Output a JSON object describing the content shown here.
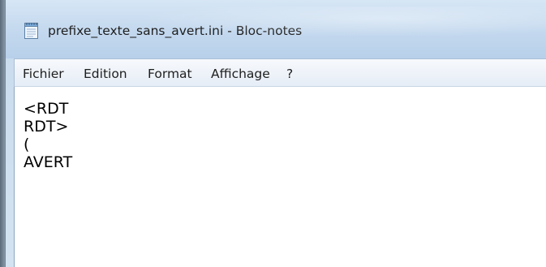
{
  "window": {
    "title": "prefixe_texte_sans_avert.ini - Bloc-notes",
    "icon": "notepad-icon"
  },
  "menu": {
    "items": [
      {
        "label": "Fichier"
      },
      {
        "label": "Edition"
      },
      {
        "label": "Format"
      },
      {
        "label": "Affichage"
      },
      {
        "label": "?"
      }
    ]
  },
  "editor": {
    "lines": [
      "<RDT",
      "RDT>",
      "(",
      "AVERT"
    ]
  },
  "colors": {
    "titlebar": "#c3d8ee",
    "menubar": "#eef3f9",
    "editor_bg": "#ffffff",
    "text": "#000000"
  }
}
